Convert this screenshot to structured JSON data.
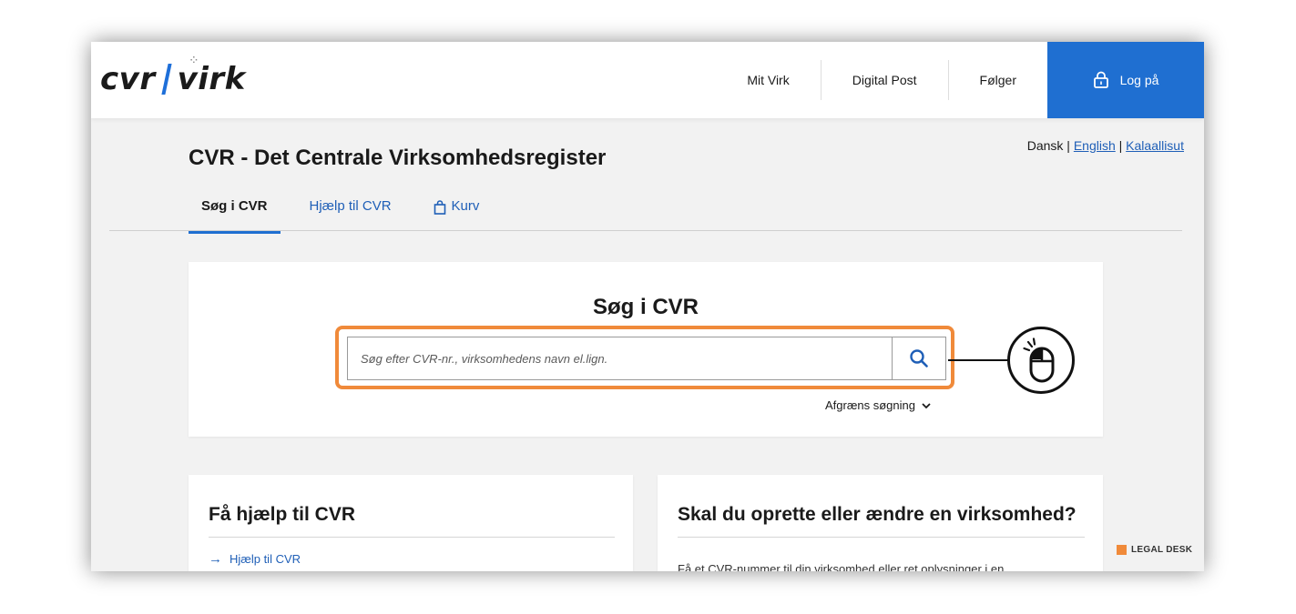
{
  "header": {
    "logo_left": "cvr",
    "logo_right": "virk",
    "nav": [
      "Mit Virk",
      "Digital Post",
      "Følger"
    ],
    "login_label": "Log på"
  },
  "languages": {
    "dansk": "Dansk",
    "sep1": "|",
    "english": "English",
    "sep2": "|",
    "kalaallisut": "Kalaallisut"
  },
  "page_title": "CVR - Det Centrale Virksomhedsregister",
  "tabs": [
    {
      "label": "Søg i CVR",
      "active": true
    },
    {
      "label": "Hjælp til CVR",
      "active": false
    },
    {
      "label": "Kurv",
      "active": false
    }
  ],
  "search": {
    "title": "Søg i CVR",
    "placeholder": "Søg efter CVR-nr., virksomhedens navn el.lign.",
    "value": "",
    "refine_label": "Afgræns søgning"
  },
  "cards": {
    "left": {
      "title": "Få hjælp til CVR",
      "link": "Hjælp til CVR"
    },
    "right": {
      "title": "Skal du oprette eller ændre en virksomhed?",
      "text": "Få et CVR-nummer til din virksomhed eller ret oplysninger i en"
    }
  },
  "legal_desk": "LEGAL DESK",
  "colors": {
    "accent": "#1f6fd1",
    "highlight": "#f08a3a",
    "link": "#1f5fb7"
  },
  "icons": [
    "lock-icon",
    "search-icon",
    "chevron-down-icon",
    "mouse-icon",
    "bag-icon",
    "arrow-right-icon"
  ]
}
